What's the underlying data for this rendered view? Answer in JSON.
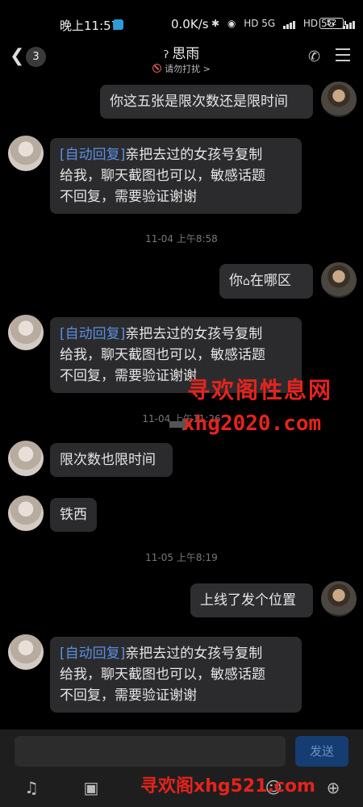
{
  "status_bar": {
    "time": "晚上11:57",
    "speed": "0.0K/s",
    "net1": "HD 5G",
    "net2": "HD 5G",
    "battery": "52"
  },
  "header": {
    "unread_count": "3",
    "contact_name": "思雨",
    "subtitle": "请勿打扰 >"
  },
  "messages": [
    {
      "side": "out",
      "text": "你这五张是限次数还是限时间"
    },
    {
      "side": "in",
      "auto_tag": "[自动回复]",
      "lines": [
        "亲把去过的女孩号复制",
        "给我，聊天截图也可以，敏感话题",
        "不回复，需要验证谢谢"
      ]
    },
    {
      "timestamp": "11-04 上午8:58"
    },
    {
      "side": "out",
      "before": "你",
      "icon": "house",
      "after": "在哪区"
    },
    {
      "side": "in",
      "auto_tag": "[自动回复]",
      "lines": [
        "亲把去过的女孩号复制",
        "给我，聊天截图也可以，敏感话题",
        "不回复，需要验证谢谢"
      ]
    },
    {
      "timestamp": "11-04 上午11:26"
    },
    {
      "side": "in",
      "text": "限次数也限时间"
    },
    {
      "side": "in",
      "text": "铁西"
    },
    {
      "timestamp": "11-05 上午8:19"
    },
    {
      "side": "out",
      "text": "上线了发个位置"
    },
    {
      "side": "in",
      "auto_tag": "[自动回复]",
      "lines": [
        "亲把去过的女孩号复制",
        "给我，聊天截图也可以，敏感话题",
        "不回复，需要验证谢谢"
      ]
    }
  ],
  "watermark": {
    "title": "寻欢阁性息网",
    "url": "xhg2020.com",
    "bottom": "寻欢阁xhg521.com"
  },
  "input": {
    "send_label": "发送"
  },
  "colors": {
    "background": "#000000",
    "bubble": "#2e2e30",
    "auto_tag": "#5b8fe0",
    "send_button": "#163d72",
    "watermark": "#e5231d"
  },
  "icons": [
    "back-icon",
    "phone-icon",
    "menu-icon",
    "ear-icon",
    "do-not-disturb-icon",
    "voice-icon",
    "image-icon",
    "emoji-icon",
    "plus-icon"
  ]
}
